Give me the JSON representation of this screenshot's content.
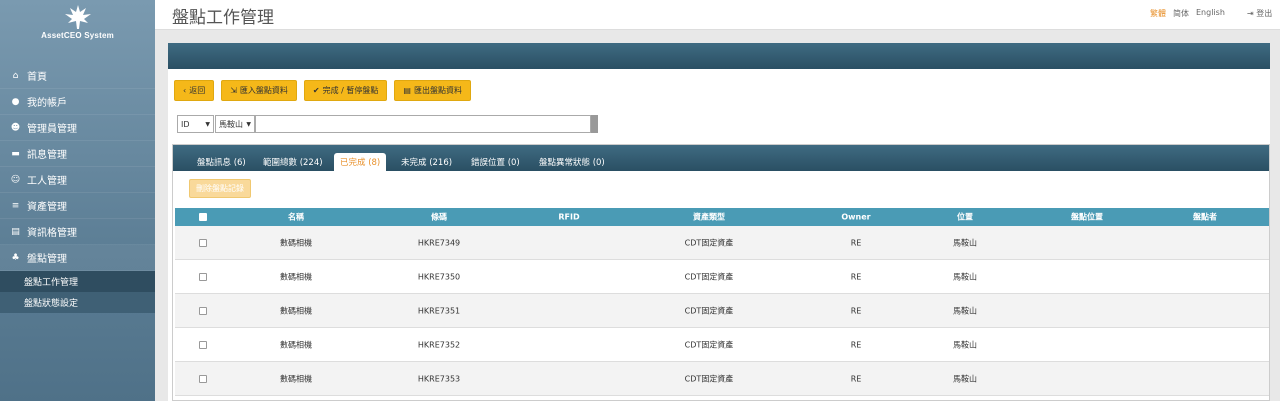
{
  "app": {
    "name": "AssetCEO System"
  },
  "sidebar": {
    "items": [
      {
        "label": "首頁",
        "icon": "home-icon",
        "glyph": "⌂"
      },
      {
        "label": "我的帳戶",
        "icon": "user-icon",
        "glyph": "●"
      },
      {
        "label": "管理員管理",
        "icon": "admin-icon",
        "glyph": "☻"
      },
      {
        "label": "訊息管理",
        "icon": "message-icon",
        "glyph": "▬"
      },
      {
        "label": "工人管理",
        "icon": "users-icon",
        "glyph": "☺"
      },
      {
        "label": "資產管理",
        "icon": "database-icon",
        "glyph": "≡"
      },
      {
        "label": "資訊格管理",
        "icon": "grid-icon",
        "glyph": "▤"
      },
      {
        "label": "盤點管理",
        "icon": "cubes-icon",
        "glyph": "♣"
      }
    ],
    "subitems": [
      {
        "label": "盤點工作管理"
      },
      {
        "label": "盤點狀態設定"
      }
    ]
  },
  "header": {
    "title": "盤點工作管理",
    "lang_trad": "繁體",
    "lang_simp": "简体",
    "lang_en": "English",
    "logout": "登出"
  },
  "toolbar": {
    "back": "返回",
    "import": "匯入盤點資料",
    "complete": "完成 / 暫停盤點",
    "export": "匯出盤點資料"
  },
  "filters": {
    "field": "ID",
    "location": "馬鞍山",
    "query": ""
  },
  "tabs": [
    {
      "label": "盤點訊息 (6)"
    },
    {
      "label": "範圍總數 (224)"
    },
    {
      "label": "已完成 (8)"
    },
    {
      "label": "未完成 (216)"
    },
    {
      "label": "錯誤位置 (0)"
    },
    {
      "label": "盤點異常狀態 (0)"
    }
  ],
  "actions": {
    "delete": "刪除盤點記錄"
  },
  "table": {
    "headers": [
      "名稱",
      "條碼",
      "RFID",
      "資產類型",
      "Owner",
      "位置",
      "盤點位置",
      "盤點者"
    ],
    "rows": [
      {
        "name": "數碼相機",
        "barcode": "HKRE7349",
        "rfid": "",
        "type": "CDT固定資產",
        "owner": "RE",
        "location": "馬鞍山",
        "check_location": "",
        "checker": ""
      },
      {
        "name": "數碼相機",
        "barcode": "HKRE7350",
        "rfid": "",
        "type": "CDT固定資產",
        "owner": "RE",
        "location": "馬鞍山",
        "check_location": "",
        "checker": ""
      },
      {
        "name": "數碼相機",
        "barcode": "HKRE7351",
        "rfid": "",
        "type": "CDT固定資產",
        "owner": "RE",
        "location": "馬鞍山",
        "check_location": "",
        "checker": ""
      },
      {
        "name": "數碼相機",
        "barcode": "HKRE7352",
        "rfid": "",
        "type": "CDT固定資產",
        "owner": "RE",
        "location": "馬鞍山",
        "check_location": "",
        "checker": ""
      },
      {
        "name": "數碼相機",
        "barcode": "HKRE7353",
        "rfid": "",
        "type": "CDT固定資產",
        "owner": "RE",
        "location": "馬鞍山",
        "check_location": "",
        "checker": ""
      }
    ]
  },
  "colors": {
    "accent": "#f5b819",
    "active_tab": "#e8912c",
    "table_header": "#4a9bb5",
    "sidebar": "#5d7f96"
  }
}
